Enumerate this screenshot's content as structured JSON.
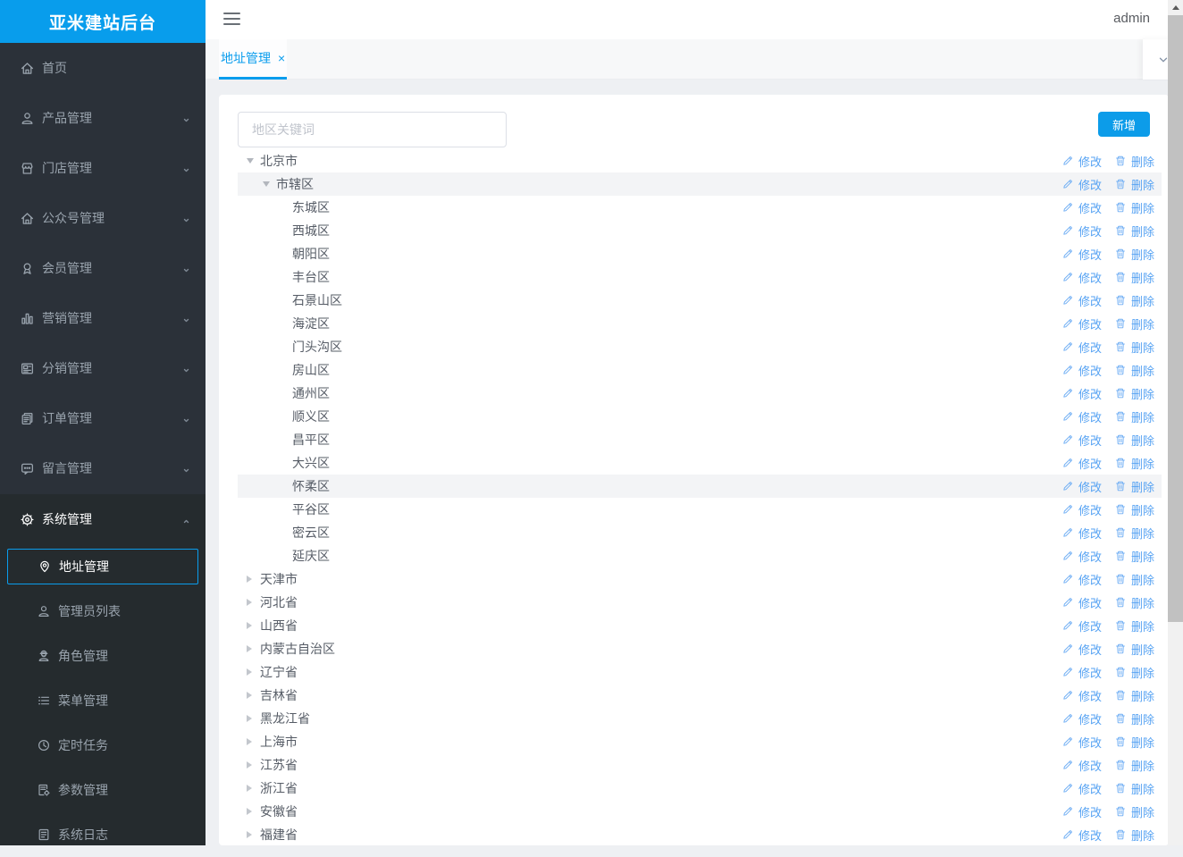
{
  "app": {
    "logo_title": "亚米建站后台",
    "user_name": "admin"
  },
  "colors": {
    "accent_blue": "#0a9ded",
    "sidebar_bg": "#2b3139",
    "sidebar_open_bg": "#252b2e",
    "link_blue": "#57a3f3",
    "highlight_row": "#f3f4f6"
  },
  "sidebar": {
    "items": [
      {
        "label": "首页",
        "icon": "home-icon",
        "chevron": null
      },
      {
        "label": "产品管理",
        "icon": "product-user-icon",
        "chevron": "down"
      },
      {
        "label": "门店管理",
        "icon": "store-icon",
        "chevron": "down"
      },
      {
        "label": "公众号管理",
        "icon": "official-account-icon",
        "chevron": "down"
      },
      {
        "label": "会员管理",
        "icon": "member-badge-icon",
        "chevron": "down"
      },
      {
        "label": "营销管理",
        "icon": "bar-chart-icon",
        "chevron": "down"
      },
      {
        "label": "分销管理",
        "icon": "news-icon",
        "chevron": "down"
      },
      {
        "label": "订单管理",
        "icon": "order-doc-icon",
        "chevron": "down"
      },
      {
        "label": "留言管理",
        "icon": "message-icon",
        "chevron": "down"
      },
      {
        "label": "系统管理",
        "icon": "gear-icon",
        "chevron": "up",
        "active_section": true
      }
    ],
    "subitems": [
      {
        "label": "地址管理",
        "icon": "location-pin-icon",
        "selected": true
      },
      {
        "label": "管理员列表",
        "icon": "admin-user-icon"
      },
      {
        "label": "角色管理",
        "icon": "role-worker-icon"
      },
      {
        "label": "菜单管理",
        "icon": "menu-list-icon"
      },
      {
        "label": "定时任务",
        "icon": "clock-icon"
      },
      {
        "label": "参数管理",
        "icon": "params-doc-icon"
      },
      {
        "label": "系统日志",
        "icon": "log-doc-icon"
      }
    ]
  },
  "tabbar": {
    "active_tab": "地址管理",
    "close_glyph": "×"
  },
  "toolbar": {
    "search_placeholder": "地区关键词",
    "add_label": "新增"
  },
  "tree": {
    "edit_label": "修改",
    "delete_label": "删除",
    "rows": [
      {
        "label": "北京市",
        "level": 0,
        "caret": "down"
      },
      {
        "label": "市辖区",
        "level": 1,
        "caret": "down",
        "highlight": true
      },
      {
        "label": "东城区",
        "level": 2,
        "caret": null
      },
      {
        "label": "西城区",
        "level": 2,
        "caret": null
      },
      {
        "label": "朝阳区",
        "level": 2,
        "caret": null
      },
      {
        "label": "丰台区",
        "level": 2,
        "caret": null
      },
      {
        "label": "石景山区",
        "level": 2,
        "caret": null
      },
      {
        "label": "海淀区",
        "level": 2,
        "caret": null
      },
      {
        "label": "门头沟区",
        "level": 2,
        "caret": null
      },
      {
        "label": "房山区",
        "level": 2,
        "caret": null
      },
      {
        "label": "通州区",
        "level": 2,
        "caret": null
      },
      {
        "label": "顺义区",
        "level": 2,
        "caret": null
      },
      {
        "label": "昌平区",
        "level": 2,
        "caret": null
      },
      {
        "label": "大兴区",
        "level": 2,
        "caret": null
      },
      {
        "label": "怀柔区",
        "level": 2,
        "caret": null,
        "highlight": true
      },
      {
        "label": "平谷区",
        "level": 2,
        "caret": null
      },
      {
        "label": "密云区",
        "level": 2,
        "caret": null
      },
      {
        "label": "延庆区",
        "level": 2,
        "caret": null
      },
      {
        "label": "天津市",
        "level": 0,
        "caret": "right"
      },
      {
        "label": "河北省",
        "level": 0,
        "caret": "right"
      },
      {
        "label": "山西省",
        "level": 0,
        "caret": "right"
      },
      {
        "label": "内蒙古自治区",
        "level": 0,
        "caret": "right"
      },
      {
        "label": "辽宁省",
        "level": 0,
        "caret": "right"
      },
      {
        "label": "吉林省",
        "level": 0,
        "caret": "right"
      },
      {
        "label": "黑龙江省",
        "level": 0,
        "caret": "right"
      },
      {
        "label": "上海市",
        "level": 0,
        "caret": "right"
      },
      {
        "label": "江苏省",
        "level": 0,
        "caret": "right"
      },
      {
        "label": "浙江省",
        "level": 0,
        "caret": "right"
      },
      {
        "label": "安徽省",
        "level": 0,
        "caret": "right"
      },
      {
        "label": "福建省",
        "level": 0,
        "caret": "right"
      }
    ]
  }
}
